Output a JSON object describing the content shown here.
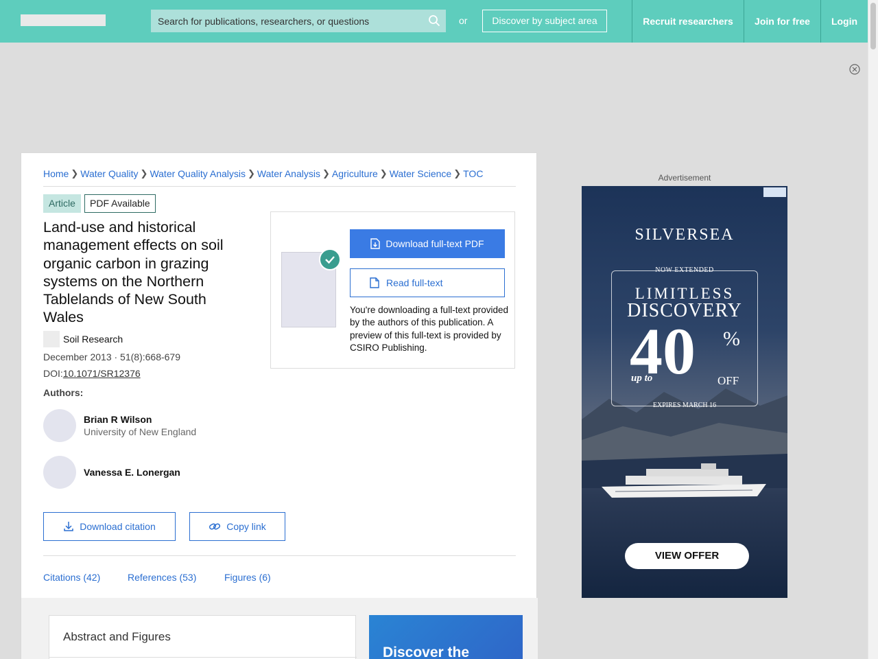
{
  "header": {
    "search_placeholder": "Search for publications, researchers, or questions",
    "or_label": "or",
    "discover_label": "Discover by subject area",
    "recruit_label": "Recruit researchers",
    "join_label": "Join for free",
    "login_label": "Login"
  },
  "breadcrumb": [
    "Home",
    "Water Quality",
    "Water Quality Analysis",
    "Water Analysis",
    "Agriculture",
    "Water Science",
    "TOC"
  ],
  "article": {
    "type_badge": "Article",
    "pdf_badge": "PDF Available",
    "title": "Land-use and historical management effects on soil organic carbon in grazing systems on the Northern Tablelands of New South Wales",
    "journal": "Soil Research",
    "date_volume": "December 2013 · 51(8):668-679",
    "doi_label": "DOI:",
    "doi": "10.1071/SR12376",
    "authors_label": "Authors:",
    "authors": [
      {
        "name": "Brian R Wilson",
        "affiliation": "University of New England"
      },
      {
        "name": "Vanessa E. Lonergan",
        "affiliation": ""
      }
    ]
  },
  "actions": {
    "download_citation": "Download citation",
    "copy_link": "Copy link"
  },
  "tabs": [
    "Citations (42)",
    "References (53)",
    "Figures (6)"
  ],
  "download_box": {
    "primary_label": "Download full-text PDF",
    "read_label": "Read full-text",
    "note": "You're downloading a full-text provided by the authors of this publication. A preview of this full-text is provided by CSIRO Publishing."
  },
  "lower": {
    "abstract_title": "Abstract and Figures",
    "promo_text": "Discover the"
  },
  "ad": {
    "label": "Advertisement",
    "brand": "SILVERSEA",
    "extended": "NOW EXTENDED",
    "line1": "LIMITLESS",
    "line2": "DISCOVERY",
    "big_number": "40",
    "percent": "%",
    "up_to": "up to",
    "off": "OFF",
    "expires": "EXPIRES MARCH 16",
    "cta": "VIEW OFFER"
  },
  "colors": {
    "header_bg": "#5ecdbd",
    "link": "#2a6ed1",
    "primary_button": "#3a7be4",
    "check_badge": "#3a9d8f"
  }
}
